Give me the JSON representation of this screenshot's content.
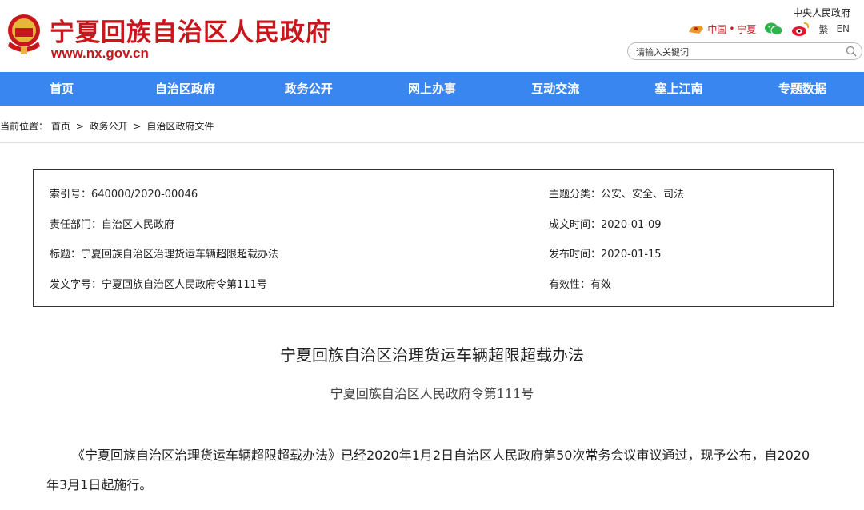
{
  "header": {
    "site_title": "宁夏回族自治区人民政府",
    "site_url": "www.nx.gov.cn",
    "central_link": "中央人民政府",
    "china_label": "中国",
    "ningxia_label": "宁夏",
    "traditional_label": "繁",
    "english_label": "EN",
    "search_placeholder": "请输入关键词",
    "brand_color": "#c8161d"
  },
  "nav": {
    "color": "#3a86f0",
    "items": [
      "首页",
      "自治区政府",
      "政务公开",
      "网上办事",
      "互动交流",
      "塞上江南",
      "专题数据"
    ]
  },
  "breadcrumb": {
    "prefix": "当前位置：",
    "items": [
      "首页",
      "政务公开",
      "自治区政府文件"
    ],
    "separator": ">"
  },
  "meta": {
    "index_no": "索引号：640000/2020-00046",
    "department": "责任部门：自治区人民政府",
    "title": "标题：宁夏回族自治区治理货运车辆超限超载办法",
    "doc_no": "发文字号：宁夏回族自治区人民政府令第111号",
    "topic": "主题分类：公安、安全、司法",
    "written_date": "成文时间：2020-01-09",
    "publish_date": "发布时间：2020-01-15",
    "validity": "有效性：有效"
  },
  "article": {
    "title": "宁夏回族自治区治理货运车辆超限超载办法",
    "subtitle": "宁夏回族自治区人民政府令第111号",
    "body": "《宁夏回族自治区治理货运车辆超限超载办法》已经2020年1月2日自治区人民政府第50次常务会议审议通过，现予公布，自2020年3月1日起施行。"
  }
}
